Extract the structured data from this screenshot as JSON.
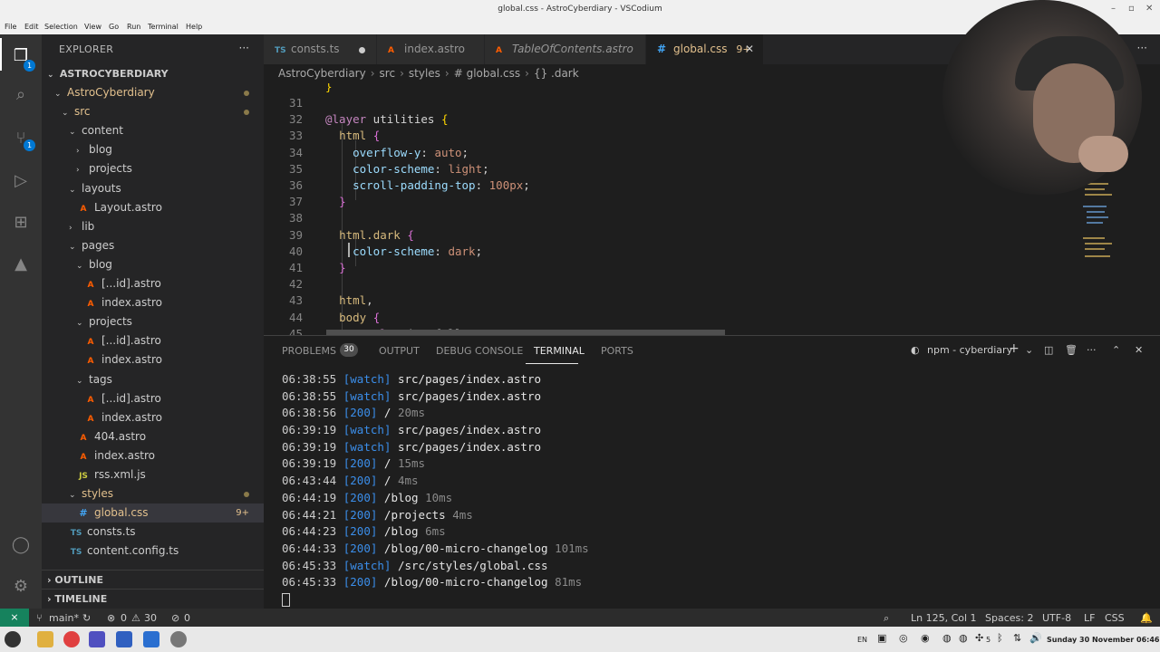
{
  "window": {
    "title": "global.css - AstroCyberdiary - VSCodium"
  },
  "menu": [
    "File",
    "Edit",
    "Selection",
    "View",
    "Go",
    "Run",
    "Terminal",
    "Help"
  ],
  "activity": {
    "explorer_badge": "1",
    "scm_badge": "1"
  },
  "sidebar": {
    "title": "EXPLORER",
    "workspace": "ASTROCYBERDIARY",
    "tree": [
      {
        "label": "AstroCyberdiary",
        "type": "folder",
        "open": true,
        "modified": true,
        "dot": true
      },
      {
        "label": "src",
        "type": "folder",
        "open": true,
        "modified": true,
        "dot": true
      },
      {
        "label": "content",
        "type": "folder",
        "open": true
      },
      {
        "label": "blog",
        "type": "folder",
        "open": false
      },
      {
        "label": "projects",
        "type": "folder",
        "open": false
      },
      {
        "label": "layouts",
        "type": "folder",
        "open": true
      },
      {
        "label": "Layout.astro",
        "type": "astro"
      },
      {
        "label": "lib",
        "type": "folder",
        "open": false
      },
      {
        "label": "pages",
        "type": "folder",
        "open": true
      },
      {
        "label": "blog",
        "type": "folder",
        "open": true
      },
      {
        "label": "[...id].astro",
        "type": "astro"
      },
      {
        "label": "index.astro",
        "type": "astro"
      },
      {
        "label": "projects",
        "type": "folder",
        "open": true
      },
      {
        "label": "[...id].astro",
        "type": "astro"
      },
      {
        "label": "index.astro",
        "type": "astro"
      },
      {
        "label": "tags",
        "type": "folder",
        "open": true
      },
      {
        "label": "[...id].astro",
        "type": "astro"
      },
      {
        "label": "index.astro",
        "type": "astro"
      },
      {
        "label": "404.astro",
        "type": "astro"
      },
      {
        "label": "index.astro",
        "type": "astro"
      },
      {
        "label": "rss.xml.js",
        "type": "js"
      },
      {
        "label": "styles",
        "type": "folder",
        "open": true,
        "modified": true,
        "dot": true
      },
      {
        "label": "global.css",
        "type": "css",
        "modified": true,
        "count": "9+",
        "selected": true
      },
      {
        "label": "consts.ts",
        "type": "ts"
      },
      {
        "label": "content.config.ts",
        "type": "ts"
      }
    ],
    "outline": "OUTLINE",
    "timeline": "TIMELINE"
  },
  "tabs": [
    {
      "label": "consts.ts",
      "icon": "TS",
      "dirty": true
    },
    {
      "label": "index.astro",
      "icon": "A"
    },
    {
      "label": "TableOfContents.astro",
      "icon": "A",
      "italic": true
    },
    {
      "label": "global.css",
      "icon": "#",
      "count": "9+",
      "active": true
    }
  ],
  "breadcrumb": [
    "AstroCyberdiary",
    "src",
    "styles",
    "# global.css",
    "{} .dark"
  ],
  "editor": {
    "lines": [
      {
        "n": "31",
        "tokens": []
      },
      {
        "n": "32",
        "tokens": [
          [
            "at",
            "@layer"
          ],
          [
            "txt",
            " utilities "
          ],
          [
            "br",
            "{"
          ]
        ]
      },
      {
        "n": "33",
        "tokens": [
          [
            "txt",
            "  "
          ],
          [
            "sel",
            "html"
          ],
          [
            "txt",
            " "
          ],
          [
            "br2",
            "{"
          ]
        ]
      },
      {
        "n": "34",
        "tokens": [
          [
            "txt",
            "    "
          ],
          [
            "prop",
            "overflow-y"
          ],
          [
            "txt",
            ": "
          ],
          [
            "val",
            "auto"
          ],
          [
            "txt",
            ";"
          ]
        ]
      },
      {
        "n": "35",
        "tokens": [
          [
            "txt",
            "    "
          ],
          [
            "prop",
            "color-scheme"
          ],
          [
            "txt",
            ": "
          ],
          [
            "val",
            "light"
          ],
          [
            "txt",
            ";"
          ]
        ]
      },
      {
        "n": "36",
        "tokens": [
          [
            "txt",
            "    "
          ],
          [
            "prop",
            "scroll-padding-top"
          ],
          [
            "txt",
            ": "
          ],
          [
            "val",
            "100px"
          ],
          [
            "txt",
            ";"
          ]
        ]
      },
      {
        "n": "37",
        "tokens": [
          [
            "txt",
            "  "
          ],
          [
            "br2",
            "}"
          ]
        ]
      },
      {
        "n": "38",
        "tokens": []
      },
      {
        "n": "39",
        "tokens": [
          [
            "txt",
            "  "
          ],
          [
            "sel",
            "html.dark"
          ],
          [
            "txt",
            " "
          ],
          [
            "br2",
            "{"
          ]
        ]
      },
      {
        "n": "40",
        "tokens": [
          [
            "txt",
            "    "
          ],
          [
            "prop",
            "color-scheme"
          ],
          [
            "txt",
            ": "
          ],
          [
            "val",
            "dark"
          ],
          [
            "txt",
            ";"
          ]
        ]
      },
      {
        "n": "41",
        "tokens": [
          [
            "txt",
            "  "
          ],
          [
            "br2",
            "}"
          ]
        ]
      },
      {
        "n": "42",
        "tokens": []
      },
      {
        "n": "43",
        "tokens": [
          [
            "txt",
            "  "
          ],
          [
            "sel",
            "html"
          ],
          [
            "txt",
            ","
          ]
        ]
      },
      {
        "n": "44",
        "tokens": [
          [
            "txt",
            "  "
          ],
          [
            "sel",
            "body"
          ],
          [
            "txt",
            " "
          ],
          [
            "br2",
            "{"
          ]
        ]
      },
      {
        "n": "45",
        "tokens": [
          [
            "txt",
            "    "
          ],
          [
            "at",
            "@apply"
          ],
          [
            "txt",
            " size-full;"
          ]
        ]
      }
    ]
  },
  "panel": {
    "tabs": [
      "PROBLEMS",
      "OUTPUT",
      "DEBUG CONSOLE",
      "TERMINAL",
      "PORTS"
    ],
    "problems_count": "30",
    "active_tab": "TERMINAL",
    "terminal_name": "npm - cyberdiary",
    "terminal_lines": [
      {
        "time": "06:38:55",
        "tag": "[watch]",
        "path": "src/pages/index.astro",
        "ms": ""
      },
      {
        "time": "06:38:55",
        "tag": "[watch]",
        "path": "src/pages/index.astro",
        "ms": ""
      },
      {
        "time": "06:38:56",
        "tag": "[200]",
        "path": "/",
        "ms": "20ms"
      },
      {
        "time": "06:39:19",
        "tag": "[watch]",
        "path": "src/pages/index.astro",
        "ms": ""
      },
      {
        "time": "06:39:19",
        "tag": "[watch]",
        "path": "src/pages/index.astro",
        "ms": ""
      },
      {
        "time": "06:39:19",
        "tag": "[200]",
        "path": "/",
        "ms": "15ms"
      },
      {
        "time": "06:43:44",
        "tag": "[200]",
        "path": "/",
        "ms": "4ms"
      },
      {
        "time": "06:44:19",
        "tag": "[200]",
        "path": "/blog",
        "ms": "10ms"
      },
      {
        "time": "06:44:21",
        "tag": "[200]",
        "path": "/projects",
        "ms": "4ms"
      },
      {
        "time": "06:44:23",
        "tag": "[200]",
        "path": "/blog",
        "ms": "6ms"
      },
      {
        "time": "06:44:33",
        "tag": "[200]",
        "path": "/blog/00-micro-changelog",
        "ms": "101ms"
      },
      {
        "time": "06:45:33",
        "tag": "[watch]",
        "path": "/src/styles/global.css",
        "ms": ""
      },
      {
        "time": "06:45:33",
        "tag": "[200]",
        "path": "/blog/00-micro-changelog",
        "ms": "81ms"
      }
    ]
  },
  "status": {
    "branch": "main*",
    "errors": "0",
    "warnings": "30",
    "ports": "0",
    "position": "Ln 125, Col 1",
    "spaces": "Spaces: 2",
    "encoding": "UTF-8",
    "eol": "LF",
    "language": "CSS"
  },
  "taskbar": {
    "lang": "EN",
    "count": "5",
    "clock": "Sunday 30 November 06:46"
  },
  "colors": {
    "accent": "#0078d4",
    "modified": "#e2c08d",
    "remote": "#16825d"
  }
}
